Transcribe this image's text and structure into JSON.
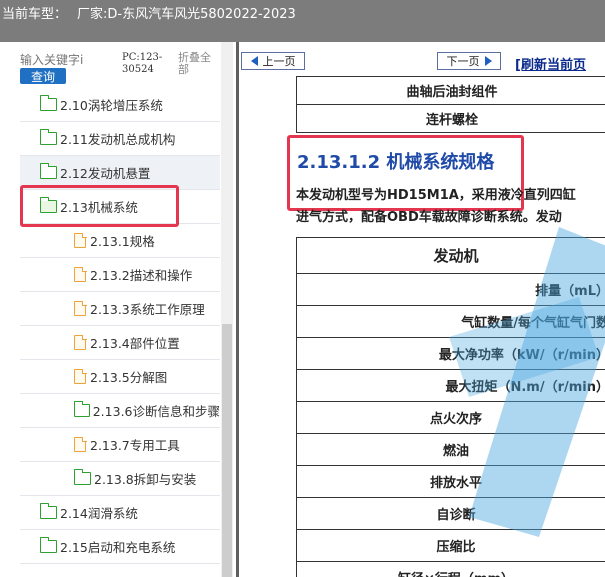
{
  "titlebar": {
    "label": "当前车型：",
    "vehicle": "厂家:D-东风汽车风光5802022-2023"
  },
  "left": {
    "search_placeholder": "输入关键字i",
    "search_button": "查询",
    "pc_code": "PC:123-30524",
    "collapse_all": "折叠全部",
    "tree": [
      {
        "label": "2.10涡轮增压系统",
        "level": 1,
        "icon": "folder-icon"
      },
      {
        "label": "2.11发动机总成机构",
        "level": 1,
        "icon": "folder-icon"
      },
      {
        "label": "2.12发动机悬置",
        "level": 1,
        "icon": "folder-icon"
      },
      {
        "label": "2.13机械系统",
        "level": 1,
        "icon": "folder-open-icon"
      },
      {
        "label": "2.13.1规格",
        "level": 2,
        "icon": "document-icon"
      },
      {
        "label": "2.13.2描述和操作",
        "level": 2,
        "icon": "document-icon"
      },
      {
        "label": "2.13.3系统工作原理",
        "level": 2,
        "icon": "document-icon"
      },
      {
        "label": "2.13.4部件位置",
        "level": 2,
        "icon": "document-icon"
      },
      {
        "label": "2.13.5分解图",
        "level": 2,
        "icon": "document-icon"
      },
      {
        "label": "2.13.6诊断信息和步骤",
        "level": 2,
        "icon": "folder-icon"
      },
      {
        "label": "2.13.7专用工具",
        "level": 2,
        "icon": "document-icon"
      },
      {
        "label": "2.13.8拆卸与安装",
        "level": 2,
        "icon": "folder-icon"
      },
      {
        "label": "2.14润滑系统",
        "level": 1,
        "icon": "folder-icon"
      },
      {
        "label": "2.15启动和充电系统",
        "level": 1,
        "icon": "folder-icon"
      }
    ]
  },
  "right": {
    "prev_label": "上一页",
    "next_label": "下一页",
    "refresh_label": "[刷新当前页",
    "top_rows": [
      "曲轴后油封组件",
      "连杆螺栓"
    ],
    "section_title": "2.13.1.2 机械系统规格",
    "para_line1": "本发动机型号为HD15M1A，采用液冷直列四缸",
    "para_line2": "进气方式，配备OBD车载故障诊断系统。发动",
    "spec_header": "发动机",
    "spec_rows": [
      "排量（mL）",
      "气缸数量/每个气缸气门数",
      "最大净功率（kW/（r/min）",
      "最大扭矩（N.m/（r/min）",
      "点火次序",
      "燃油",
      "排放水平",
      "自诊断",
      "压缩比",
      "缸径×行程（mm）"
    ]
  },
  "colors": {
    "titlebar_bg": "#7c7c7c",
    "accent_blue": "#1f6fc2",
    "highlight_red": "#e4364f",
    "folder_green": "#2fa02f",
    "doc_orange": "#f0a33c",
    "title_blue": "#1f4aa7"
  }
}
